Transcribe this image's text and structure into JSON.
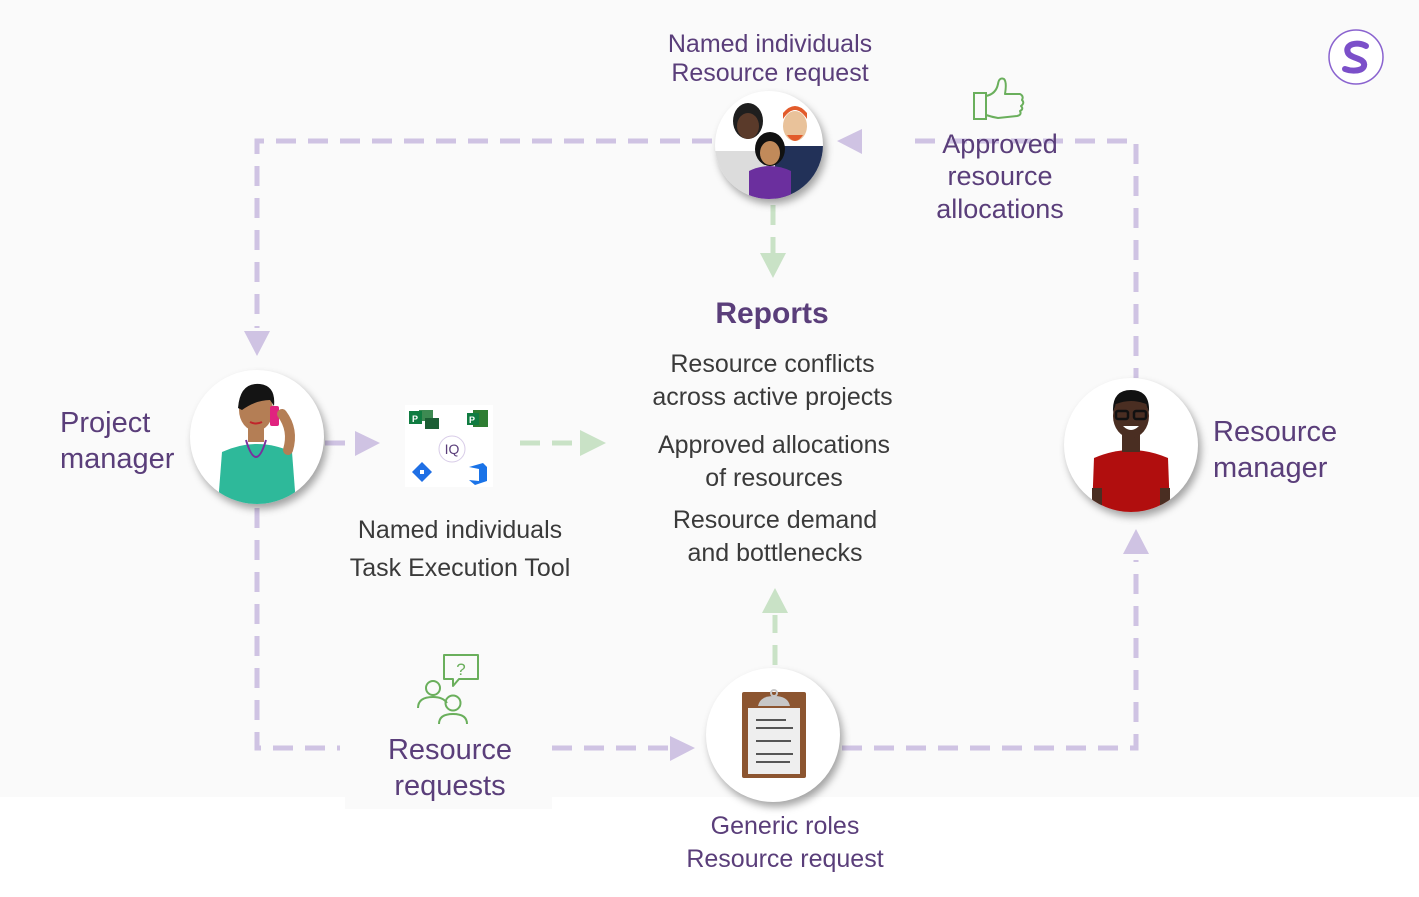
{
  "logo": {
    "letter": "S",
    "color": "#7b4fc9"
  },
  "colors": {
    "flow_purple": "#cfc3e3",
    "flow_green": "#c9e2c6",
    "label_purple": "#5a3e7a",
    "icon_green": "#6aaf5c"
  },
  "nodes": {
    "named_individuals": {
      "line1": "Named individuals",
      "line2": "Resource request"
    },
    "approved": {
      "line1": "Approved",
      "line2": "resource",
      "line3": "allocations"
    },
    "project_manager": {
      "line1": "Project",
      "line2": "manager"
    },
    "tools": {
      "center_badge": "IQ",
      "line1": "Named individuals",
      "line2": "Task Execution Tool"
    },
    "reports": {
      "title": "Reports",
      "items": [
        {
          "line1": "Resource conflicts",
          "line2": "across active projects"
        },
        {
          "line1": "Approved allocations",
          "line2": "of resources"
        },
        {
          "line1": "Resource demand",
          "line2": "and bottlenecks"
        }
      ]
    },
    "resource_manager": {
      "line1": "Resource",
      "line2": "manager"
    },
    "resource_requests": {
      "line1": "Resource",
      "line2": "requests"
    },
    "generic_roles": {
      "line1": "Generic roles",
      "line2": "Resource request"
    }
  }
}
